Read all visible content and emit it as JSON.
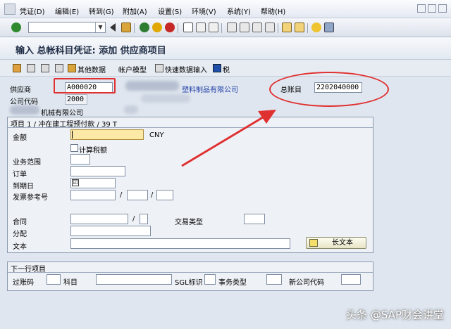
{
  "menu": [
    "凭证(D)",
    "编辑(E)",
    "转到(G)",
    "附加(A)",
    "设置(S)",
    "环境(V)",
    "系统(Y)",
    "帮助(H)"
  ],
  "title": "输入 总帐科目凭证: 添加 供应商项目",
  "app_toolbar": {
    "other_data": "其他数据",
    "account_model": "帐户模型",
    "fast_data_entry": "快速数据输入",
    "tax": "税"
  },
  "header": {
    "vendor_label": "供应商",
    "vendor_value": "A000020",
    "vendor_name": "塑料制品有限公司",
    "company_code_label": "公司代码",
    "company_code_value": "2000",
    "company_name": "机械有限公司",
    "gl_account_label": "总账目",
    "gl_account_value": "2202040000"
  },
  "item": {
    "group_title": "项目 1 / 冲在建工程预付款 / 39 T",
    "amount_label": "金额",
    "amount_value": "",
    "currency": "CNY",
    "calc_tax_label": "计算税额",
    "business_area_label": "业务范围",
    "order_label": "订单",
    "due_date_label": "到期日",
    "invoice_ref_label": "发票参考号",
    "slash": "/",
    "contract_label": "合同",
    "flow_type_label": "交易类型",
    "assignment_label": "分配",
    "text_label": "文本",
    "long_text_button": "长文本"
  },
  "next_item": {
    "group_title": "下一行项目",
    "posting_key_label": "过账码",
    "account_label": "科目",
    "sgl_label": "SGL标识",
    "trans_type_label": "事务类型",
    "new_company_code_label": "新公司代码"
  },
  "watermark": "头条 @SAP财会讲堂",
  "colors": {
    "annotation_red": "#e03131",
    "amount_field": "#fde9a6",
    "link_blue": "#2341a8"
  }
}
